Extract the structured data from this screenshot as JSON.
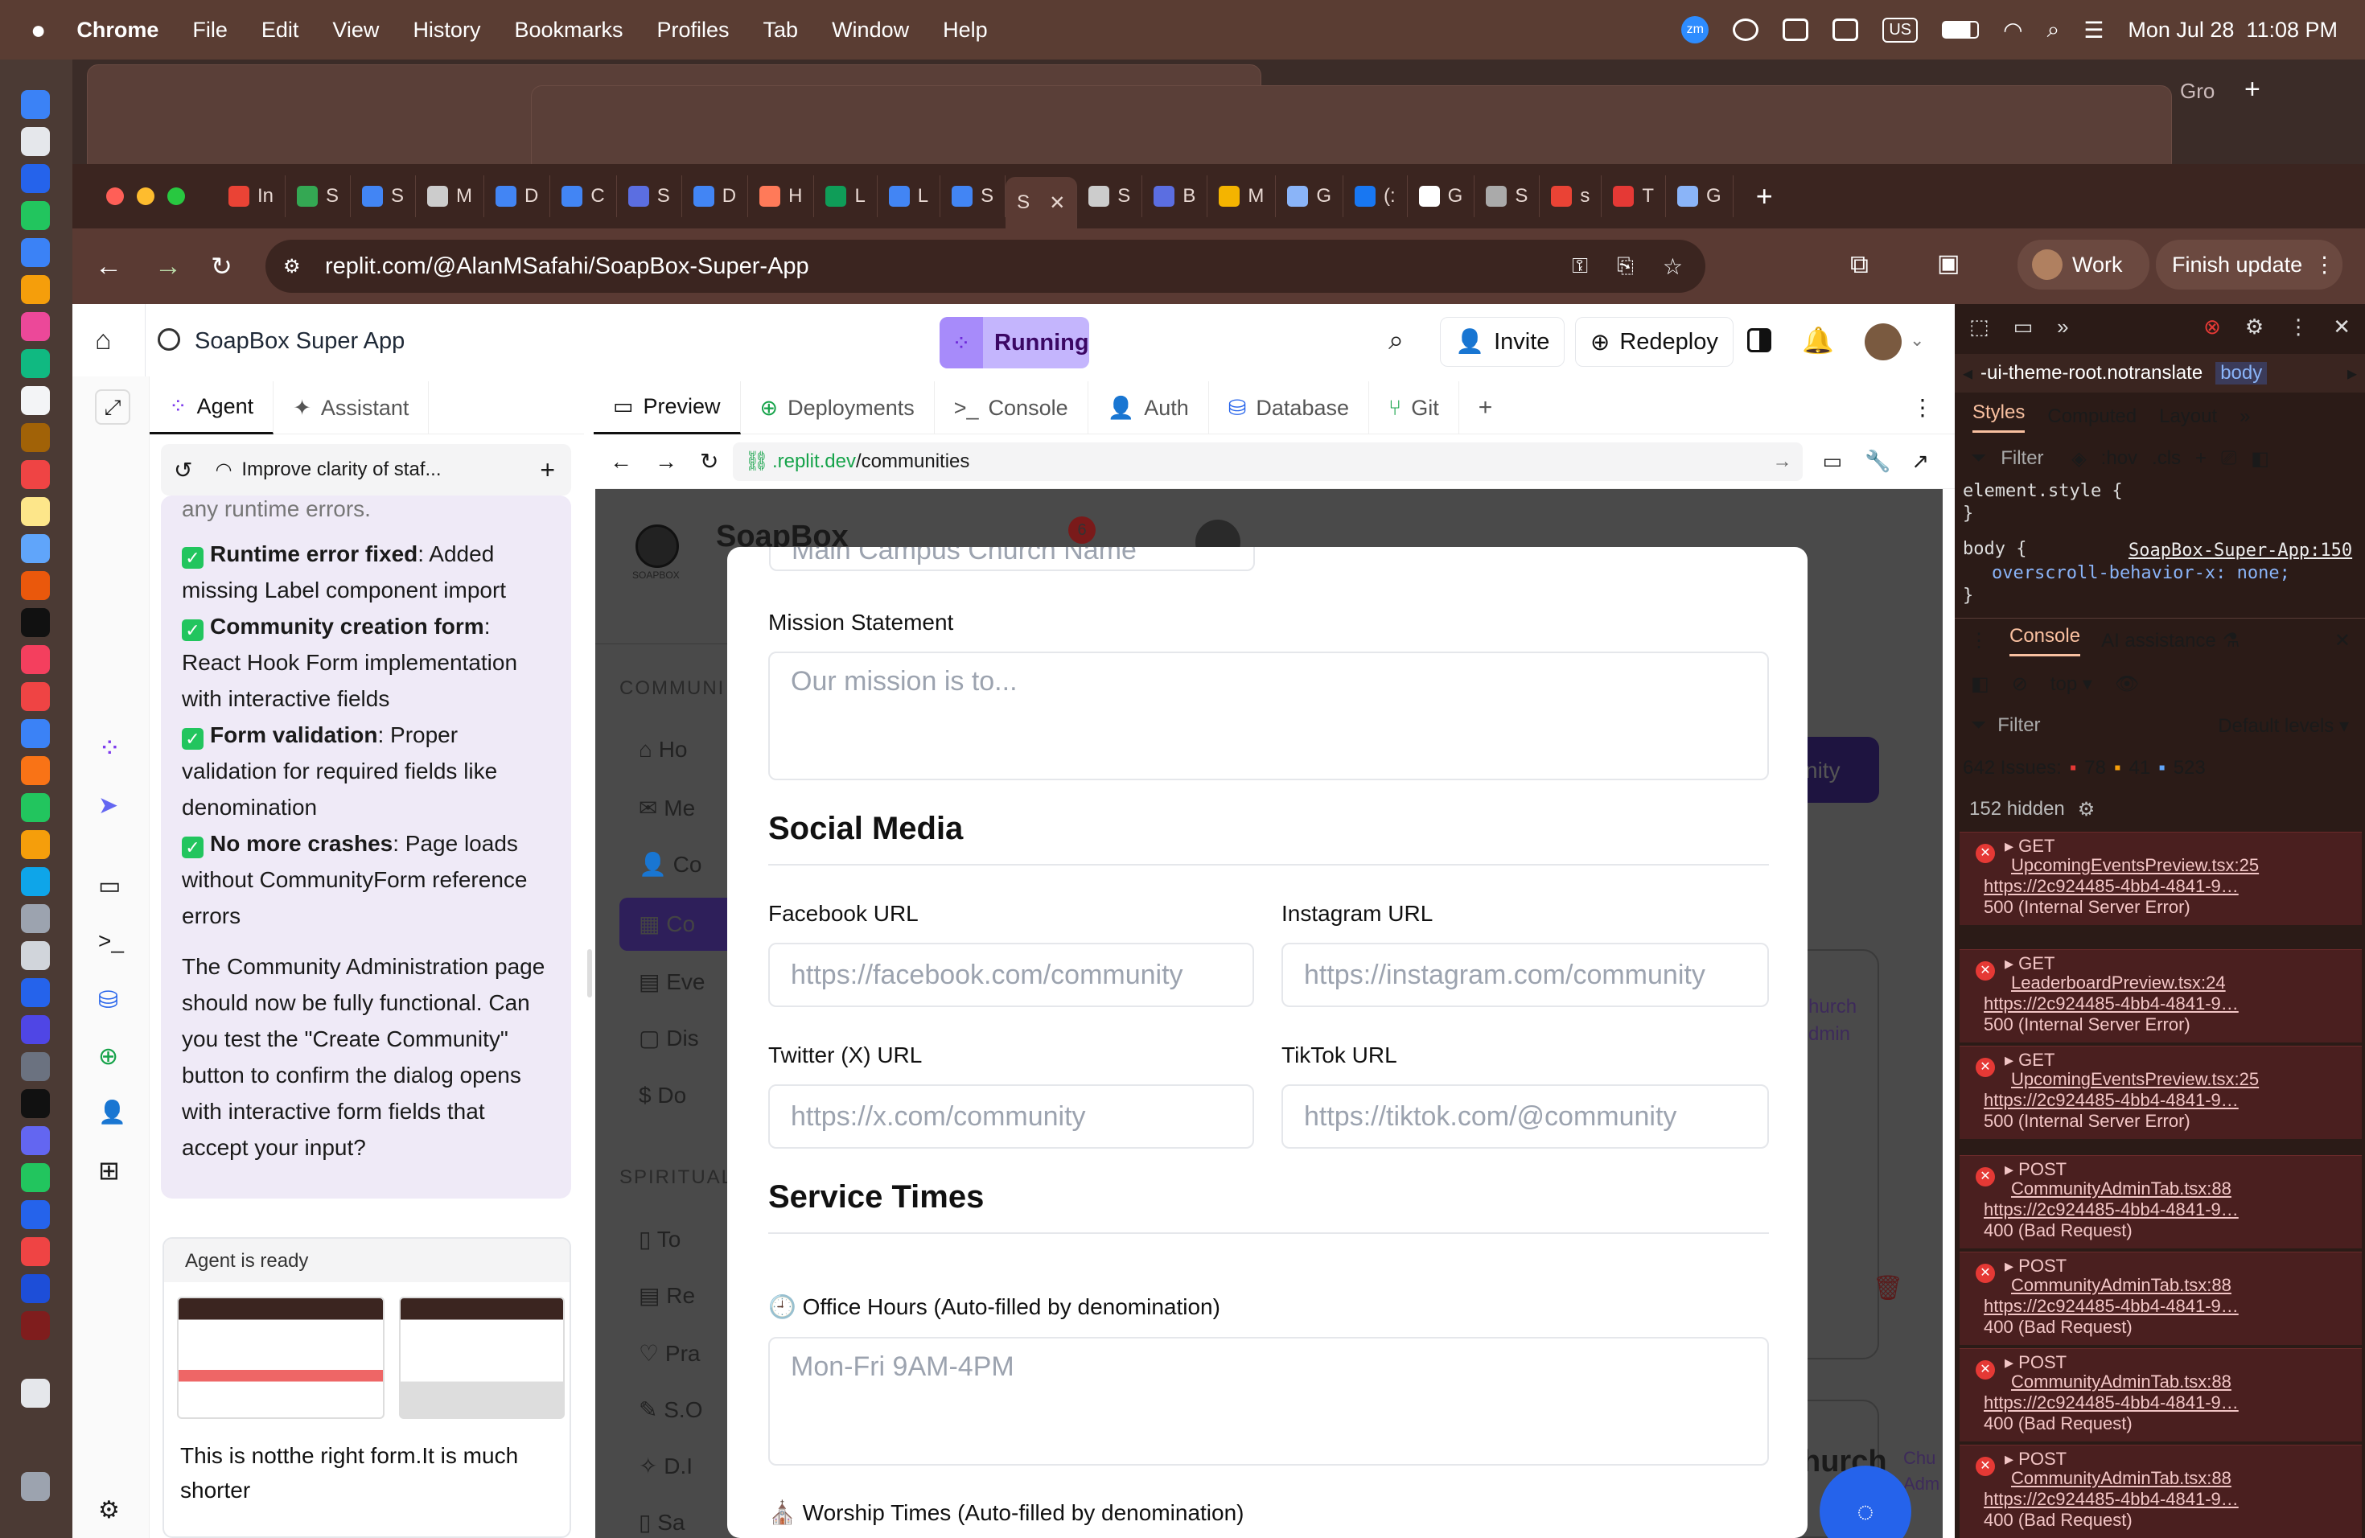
{
  "menubar": {
    "app": "Chrome",
    "items": [
      "File",
      "Edit",
      "View",
      "History",
      "Bookmarks",
      "Profiles",
      "Tab",
      "Window",
      "Help"
    ],
    "datetime": "Mon Jul 28  11:08 PM",
    "zoom_badge": "zm",
    "keyboard": "US"
  },
  "bg_window": {
    "tab_label": "Gro",
    "update_label": "Finish update"
  },
  "tabs": [
    {
      "label": "In",
      "color": "#ea4335"
    },
    {
      "label": "S",
      "color": "#34a853"
    },
    {
      "label": "S",
      "color": "#4285f4"
    },
    {
      "label": "M",
      "color": "#cccccc"
    },
    {
      "label": "D",
      "color": "#4285f4"
    },
    {
      "label": "C",
      "color": "#4285f4"
    },
    {
      "label": "S",
      "color": "#5b6ee1"
    },
    {
      "label": "D",
      "color": "#4285f4"
    },
    {
      "label": "H",
      "color": "#ff7a59"
    },
    {
      "label": "L",
      "color": "#0f9d58"
    },
    {
      "label": "L",
      "color": "#4285f4"
    },
    {
      "label": "S",
      "color": "#4285f4"
    },
    {
      "label": "S",
      "color": "#5a3a33"
    },
    {
      "label": "S",
      "color": "#cccccc"
    },
    {
      "label": "B",
      "color": "#5b6ee1"
    },
    {
      "label": "M",
      "color": "#f4b400"
    },
    {
      "label": "G",
      "color": "#8ab4f8"
    },
    {
      "label": "(:",
      "color": "#1877f2"
    },
    {
      "label": "G",
      "color": "#ffffff"
    },
    {
      "label": "S",
      "color": "#aaaaaa"
    },
    {
      "label": "s",
      "color": "#ea4335"
    },
    {
      "label": "T",
      "color": "#e53935"
    },
    {
      "label": "G",
      "color": "#8ab4f8"
    }
  ],
  "omnibox": {
    "url": "replit.com/@AlanMSafahi/SoapBox-Super-App"
  },
  "toolbar": {
    "work": "Work",
    "finish_update": "Finish update"
  },
  "replit": {
    "project": "SoapBox Super App",
    "status": "Running",
    "invite": "Invite",
    "redeploy": "Redeploy",
    "left_tabs": [
      "Agent",
      "Assistant"
    ],
    "chat_title": "Improve clarity of staf...",
    "right_tabs": [
      "Preview",
      "Deployments",
      "Console",
      "Auth",
      "Database",
      "Git"
    ],
    "preview_url_prefix": ".replit.dev",
    "preview_url_path": "/communities"
  },
  "chat": {
    "cut_line": "any runtime errors.",
    "items": [
      {
        "bold": "Runtime error fixed",
        "text": ": Added missing Label component import"
      },
      {
        "bold": "Community creation form",
        "text": ": React Hook Form implementation with interactive fields"
      },
      {
        "bold": "Form validation",
        "text": ": Proper validation for required fields like denomination"
      },
      {
        "bold": "No more crashes",
        "text": ": Page loads without CommunityForm reference errors"
      }
    ],
    "summary": "The Community Administration page should now be fully functional. Can you test the \"Create Community\" button to confirm the dialog opens with interactive form fields that accept your input?",
    "agent_status": "Agent is ready",
    "user_msg": "This is notthe right form.It is much shorter"
  },
  "app_bg": {
    "brand": "SoapBox",
    "brand_sub": "SOAPBOX",
    "notif_count": "6",
    "section1": "COMMUNI",
    "section2": "SPIRITUAL",
    "nav": [
      "Ho",
      "Me",
      "Co",
      "Co",
      "Eve",
      "Dis",
      "Do"
    ],
    "nav2": [
      "To",
      "Re",
      "Pra",
      "S.O",
      "D.I",
      "Sa"
    ],
    "right_bits": [
      "nity",
      "hurch",
      "dmin",
      "hurch",
      "Chu",
      "Adm"
    ]
  },
  "modal": {
    "cut_placeholder": "Main Campus Church Name",
    "mission_label": "Mission Statement",
    "mission_placeholder": "Our mission is to...",
    "social_heading": "Social Media",
    "facebook_label": "Facebook URL",
    "facebook_placeholder": "https://facebook.com/community",
    "instagram_label": "Instagram URL",
    "instagram_placeholder": "https://instagram.com/community",
    "twitter_label": "Twitter (X) URL",
    "twitter_placeholder": "https://x.com/community",
    "tiktok_label": "TikTok URL",
    "tiktok_placeholder": "https://tiktok.com/@community",
    "service_heading": "Service Times",
    "office_label": "Office Hours (Auto-filled by denomination)",
    "office_placeholder": "Mon-Fri 9AM-4PM",
    "worship_label": "Worship Times (Auto-filled by denomination)"
  },
  "devtools": {
    "breadcrumb": "-ui-theme-root.notranslate",
    "breadcrumb2": "body",
    "tabs": [
      "Styles",
      "Computed",
      "Layout"
    ],
    "filter": "Filter",
    "hov": ":hov",
    "cls": ".cls",
    "css": [
      "element.style {",
      "}",
      "body {",
      "SoapBox-Super-App:150",
      "overscroll-behavior-x: none;",
      "}"
    ],
    "console_tabs": [
      "Console",
      "AI assistance"
    ],
    "context": "top",
    "levels": "Default levels",
    "issues_label": "642 Issues:",
    "issues_err": "78",
    "issues_warn": "41",
    "issues_info": "523",
    "hidden": "152 hidden",
    "errors": [
      {
        "method": "GET",
        "file": "UpcomingEventsPreview.tsx:25",
        "url": "https://2c924485-4bb4-4841-9…",
        "status": "500 (Internal Server Error)"
      },
      {
        "method": "GET",
        "file": "LeaderboardPreview.tsx:24",
        "url": "https://2c924485-4bb4-4841-9…",
        "status": "500 (Internal Server Error)"
      },
      {
        "method": "GET",
        "file": "UpcomingEventsPreview.tsx:25",
        "url": "https://2c924485-4bb4-4841-9…",
        "status": "500 (Internal Server Error)"
      },
      {
        "method": "POST",
        "file": "CommunityAdminTab.tsx:88",
        "url": "https://2c924485-4bb4-4841-9…",
        "status": "400 (Bad Request)"
      },
      {
        "method": "POST",
        "file": "CommunityAdminTab.tsx:88",
        "url": "https://2c924485-4bb4-4841-9…",
        "status": "400 (Bad Request)"
      },
      {
        "method": "POST",
        "file": "CommunityAdminTab.tsx:88",
        "url": "https://2c924485-4bb4-4841-9…",
        "status": "400 (Bad Request)"
      },
      {
        "method": "POST",
        "file": "CommunityAdminTab.tsx:88",
        "url": "https://2c924485-4bb4-4841-9…",
        "status": "400 (Bad Request)"
      }
    ]
  }
}
